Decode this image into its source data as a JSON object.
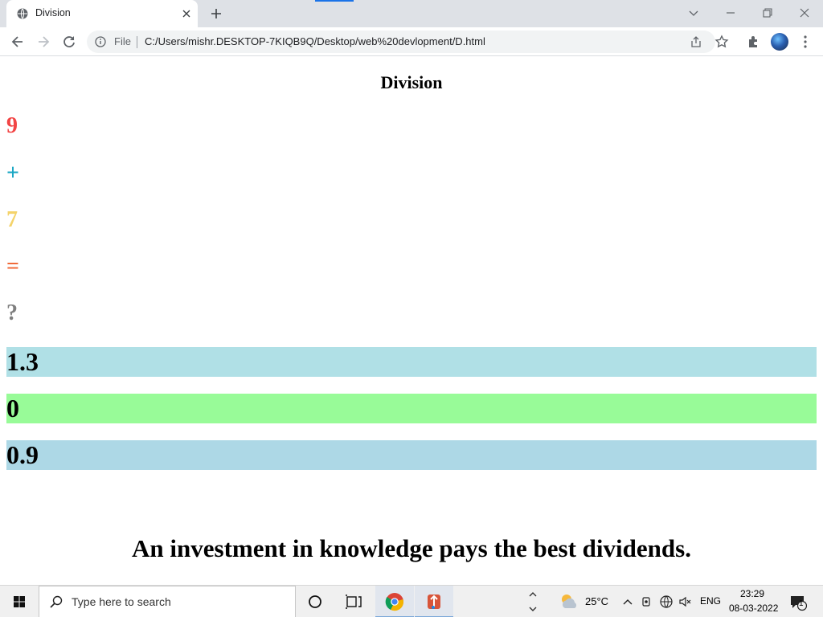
{
  "browser": {
    "tab_title": "Division",
    "file_label": "File",
    "url": "C:/Users/mishr.DESKTOP-7KIQB9Q/Desktop/web%20devlopment/D.html"
  },
  "page": {
    "heading": "Division",
    "expression": [
      {
        "text": "9",
        "color": "#f24545"
      },
      {
        "text": "+",
        "color": "#1ba7c4"
      },
      {
        "text": "7",
        "color": "#f4d36a"
      },
      {
        "text": "=",
        "color": "#f06a3a"
      },
      {
        "text": "?",
        "color": "#7f7f7f"
      }
    ],
    "options": [
      {
        "text": "1.3",
        "bg": "#b0e0e6"
      },
      {
        "text": "0",
        "bg": "#98fb98"
      },
      {
        "text": "0.9",
        "bg": "#add8e6"
      }
    ],
    "quote": "An investment in knowledge pays the best dividends."
  },
  "taskbar": {
    "search_placeholder": "Type here to search",
    "weather_temp": "25°C",
    "language": "ENG",
    "time": "23:29",
    "date": "08-03-2022",
    "notification_count": "1"
  },
  "icons": [
    "globe-icon",
    "close-icon",
    "plus-icon",
    "chevron-down-icon",
    "minimize-icon",
    "restore-icon",
    "back-arrow-icon",
    "forward-arrow-icon",
    "reload-icon",
    "info-icon",
    "share-icon",
    "star-icon",
    "extension-puzzle-icon",
    "profile-avatar",
    "more-vert-icon",
    "windows-start-icon",
    "search-icon",
    "cortana-circle-icon",
    "task-view-icon",
    "chrome-icon",
    "app-icon",
    "weather-icon",
    "chevron-up-icon",
    "meet-icon",
    "network-icon",
    "volume-muted-icon",
    "notification-icon"
  ]
}
